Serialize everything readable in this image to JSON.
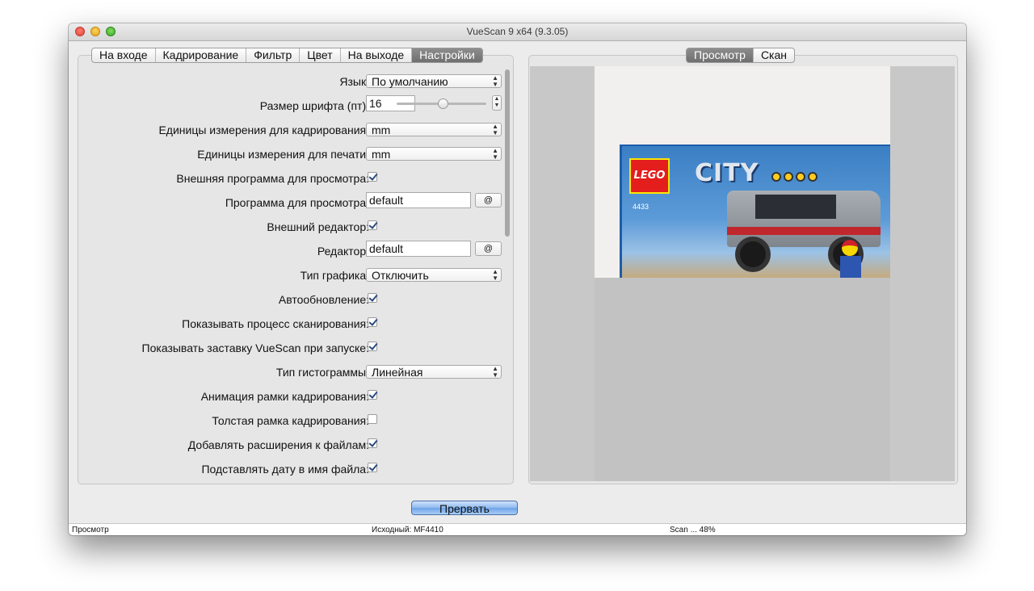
{
  "window": {
    "title": "VueScan 9 x64 (9.3.05)"
  },
  "left_tabs": [
    {
      "label": "На входе",
      "active": false
    },
    {
      "label": "Кадрирование",
      "active": false
    },
    {
      "label": "Фильтр",
      "active": false
    },
    {
      "label": "Цвет",
      "active": false
    },
    {
      "label": "На выходе",
      "active": false
    },
    {
      "label": "Настройки",
      "active": true
    }
  ],
  "right_tabs": [
    {
      "label": "Просмотр",
      "active": true
    },
    {
      "label": "Скан",
      "active": false
    }
  ],
  "settings": {
    "language": {
      "label": "Язык:",
      "value": "По умолчанию"
    },
    "font_size": {
      "label": "Размер шрифта (пт):",
      "value": "16",
      "slider_fraction": 0.52
    },
    "crop_units": {
      "label": "Единицы измерения для кадрирования:",
      "value": "mm"
    },
    "print_units": {
      "label": "Единицы измерения для печати:",
      "value": "mm"
    },
    "external_viewer": {
      "label": "Внешняя программа для просмотра:",
      "checked": true
    },
    "viewer_program": {
      "label": "Программа для просмотра:",
      "value": "default",
      "button": "@"
    },
    "external_editor": {
      "label": "Внешний редактор:",
      "checked": true
    },
    "editor": {
      "label": "Редактор:",
      "value": "default",
      "button": "@"
    },
    "graph_type": {
      "label": "Тип графика:",
      "value": "Отключить"
    },
    "auto_update": {
      "label": "Автообновление:",
      "checked": true
    },
    "show_scan_progress": {
      "label": "Показывать процесс сканирования:",
      "checked": true
    },
    "show_splash": {
      "label": "Показывать заставку VueScan при запуске:",
      "checked": true
    },
    "histogram_type": {
      "label": "Тип гистограммы:",
      "value": "Линейная"
    },
    "animate_crop": {
      "label": "Анимация рамки кадрирования:",
      "checked": true
    },
    "thick_crop": {
      "label": "Толстая рамка кадрирования:",
      "checked": false
    },
    "add_extensions": {
      "label": "Добавлять расширения к файлам:",
      "checked": true
    },
    "date_in_filename": {
      "label": "Подставлять дату в имя файла:",
      "checked": true
    }
  },
  "preview": {
    "set_number": "4433",
    "lego_text": "LEGO",
    "city_text": "CITY"
  },
  "actions": {
    "stop_label": "Прервать"
  },
  "status": {
    "mode": "Просмотр",
    "source": "Исходный: MF4410",
    "progress": "Scan ... 48%"
  }
}
